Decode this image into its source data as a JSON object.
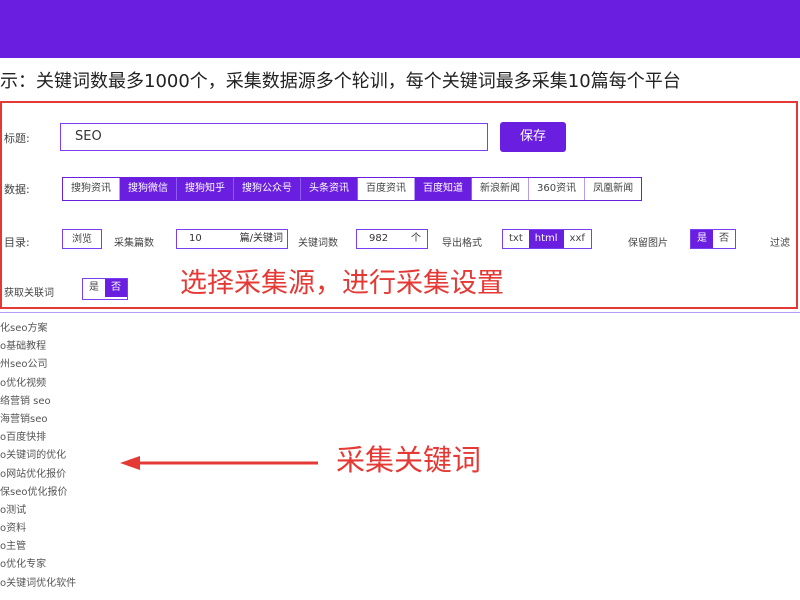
{
  "colors": {
    "accent": "#6a1fe0",
    "annotation": "#e53935"
  },
  "tip_text": "示：关键词数最多1000个，采集数据源多个轮训，每个关键词最多采集10篇每个平台",
  "panel": {
    "title_label": "标题:",
    "title_value": "SEO",
    "save_label": "保存",
    "source_label": "数据:",
    "sources": [
      {
        "label": "搜狗资讯",
        "active": false
      },
      {
        "label": "搜狗微信",
        "active": true
      },
      {
        "label": "搜狗知乎",
        "active": true
      },
      {
        "label": "搜狗公众号",
        "active": true
      },
      {
        "label": "头条资讯",
        "active": true
      },
      {
        "label": "百度资讯",
        "active": false
      },
      {
        "label": "百度知道",
        "active": true
      },
      {
        "label": "新浪新闻",
        "active": false
      },
      {
        "label": "360资讯",
        "active": false
      },
      {
        "label": "凤凰新闻",
        "active": false
      }
    ],
    "dir_label": "目录:",
    "browse_label": "浏览",
    "count_label": "采集篇数",
    "count_value": "10",
    "count_unit": "篇/关键词",
    "kw_count_label": "关键词数",
    "kw_count_value": "982",
    "kw_count_unit": "个",
    "export_label": "导出格式",
    "export_formats": [
      {
        "label": "txt",
        "active": false
      },
      {
        "label": "html",
        "active": true
      },
      {
        "label": "xxf",
        "active": false
      }
    ],
    "keep_image_label": "保留图片",
    "keep_image_options": [
      {
        "label": "是",
        "active": true
      },
      {
        "label": "否",
        "active": false
      }
    ],
    "filter_label": "过滤",
    "related_label": "获取关联词",
    "related_options": [
      {
        "label": "是",
        "active": false
      },
      {
        "label": "否",
        "active": true
      }
    ],
    "annotation": "选择采集源，进行采集设置"
  },
  "keywords": [
    "化seo方案",
    "o基础教程",
    "州seo公司",
    "o优化视频",
    "络营销 seo",
    "海营销seo",
    "o百度快排",
    "o关键词的优化",
    "o网站优化报价",
    "保seo优化报价",
    "o测试",
    "o资料",
    "o主管",
    "o优化专家",
    "o关键词优化软件"
  ],
  "keyword_annotation": "采集关键词"
}
